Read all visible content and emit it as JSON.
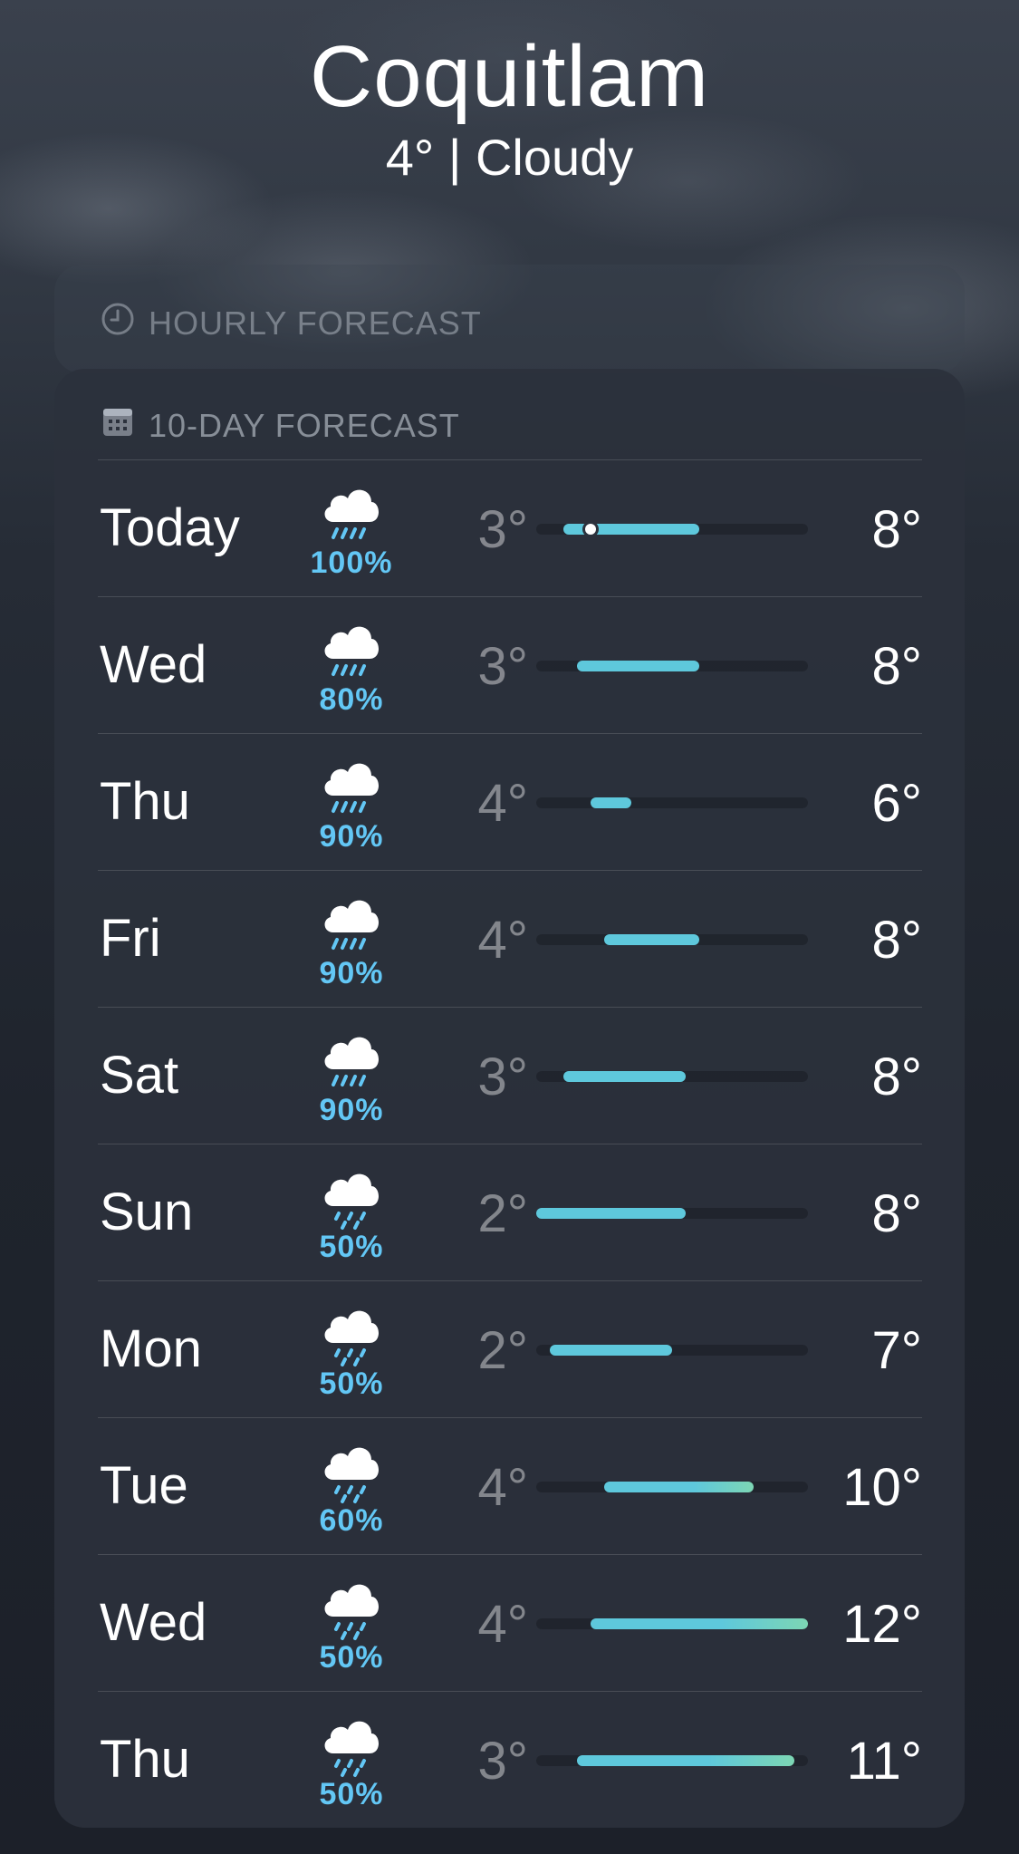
{
  "location": {
    "city": "Coquitlam",
    "summary": "4°  |  Cloudy"
  },
  "hourly": {
    "title": "HOURLY FORECAST",
    "icon": "clock-icon"
  },
  "daily": {
    "title": "10-DAY FORECAST",
    "icon": "calendar-icon",
    "range_min": 2,
    "range_max": 12,
    "current_temp": 4,
    "rows": [
      {
        "day": "Today",
        "icon": "rain-cloud-icon",
        "pop": "100%",
        "low": "3°",
        "high": "8°",
        "low_val": 3,
        "high_val": 8,
        "show_current": true
      },
      {
        "day": "Wed",
        "icon": "rain-cloud-icon",
        "pop": "80%",
        "low": "3°",
        "high": "8°",
        "low_val": 3.5,
        "high_val": 8
      },
      {
        "day": "Thu",
        "icon": "rain-cloud-icon",
        "pop": "90%",
        "low": "4°",
        "high": "6°",
        "low_val": 4,
        "high_val": 5.5
      },
      {
        "day": "Fri",
        "icon": "rain-cloud-icon",
        "pop": "90%",
        "low": "4°",
        "high": "8°",
        "low_val": 4.5,
        "high_val": 8
      },
      {
        "day": "Sat",
        "icon": "rain-cloud-icon",
        "pop": "90%",
        "low": "3°",
        "high": "8°",
        "low_val": 3,
        "high_val": 7.5
      },
      {
        "day": "Sun",
        "icon": "drizzle-cloud-icon",
        "pop": "50%",
        "low": "2°",
        "high": "8°",
        "low_val": 2,
        "high_val": 7.5
      },
      {
        "day": "Mon",
        "icon": "drizzle-cloud-icon",
        "pop": "50%",
        "low": "2°",
        "high": "7°",
        "low_val": 2.5,
        "high_val": 7
      },
      {
        "day": "Tue",
        "icon": "drizzle-cloud-icon",
        "pop": "60%",
        "low": "4°",
        "high": "10°",
        "low_val": 4.5,
        "high_val": 10
      },
      {
        "day": "Wed",
        "icon": "drizzle-cloud-icon",
        "pop": "50%",
        "low": "4°",
        "high": "12°",
        "low_val": 4,
        "high_val": 12
      },
      {
        "day": "Thu",
        "icon": "drizzle-cloud-icon",
        "pop": "50%",
        "low": "3°",
        "high": "11°",
        "low_val": 3.5,
        "high_val": 11.5
      }
    ]
  },
  "colors": {
    "bar_cool": "#5ec8dc",
    "bar_warm": "#7dd6b4",
    "precip": "#63c7f5"
  }
}
